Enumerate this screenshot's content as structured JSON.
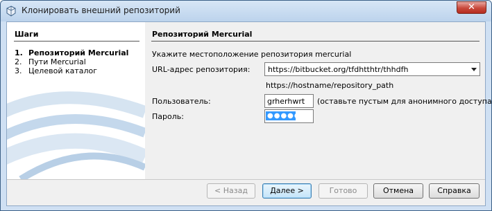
{
  "window": {
    "title": "Клонировать внешний репозиторий",
    "close_label": "✕"
  },
  "steps_panel": {
    "title": "Шаги",
    "steps": [
      {
        "num": "1.",
        "label": "Репозиторий Mercurial",
        "active": true
      },
      {
        "num": "2.",
        "label": "Пути Mercurial",
        "active": false
      },
      {
        "num": "3.",
        "label": "Целевой каталог",
        "active": false
      }
    ]
  },
  "form": {
    "title": "Репозиторий Mercurial",
    "description": "Укажите местоположение репозитория mercurial",
    "url_label": "URL-адрес репозитория:",
    "url_value": "https://bitbucket.org/tfdhtthtr/thhdfh",
    "url_hint": "https://hostname/repository_path",
    "user_label": "Пользователь:",
    "user_value": "grherhwrt",
    "user_hint": "(оставьте пустым для анонимного доступа)",
    "password_label": "Пароль:",
    "password_masked": "●●●●●●"
  },
  "buttons": {
    "back": "< Назад",
    "next": "Далее >",
    "finish": "Готово",
    "cancel": "Отмена",
    "help": "Справка"
  },
  "colors": {
    "selection": "#3399ff",
    "window_frame": "#cfe0f3",
    "close_button": "#c8483b"
  }
}
